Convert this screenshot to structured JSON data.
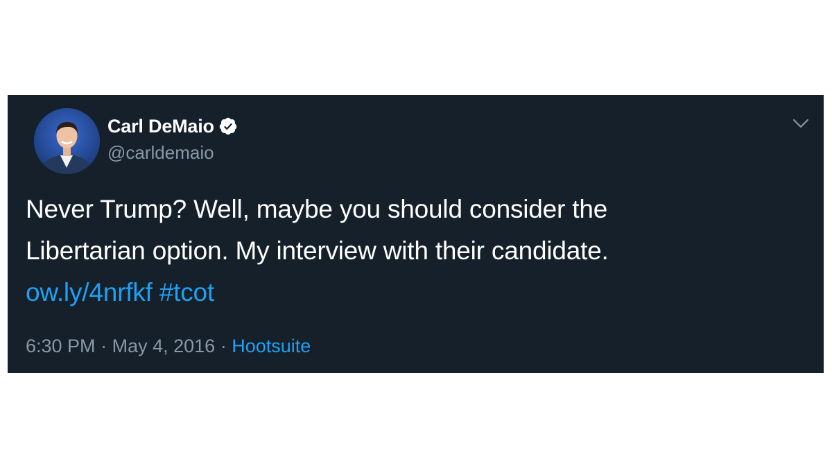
{
  "tweet": {
    "author": {
      "name": "Carl DeMaio",
      "handle": "@carldemaio",
      "verified": true,
      "verified_icon": "verified-badge-icon",
      "avatar_icon": "profile-photo"
    },
    "menu_icon": "chevron-down-icon",
    "text_lines": [
      "Never Trump? Well, maybe you should consider the",
      "Libertarian option.  My interview with their candidate."
    ],
    "link": "ow.ly/4nrfkf",
    "hashtag": "#tcot",
    "time": "6:30 PM",
    "separator": "·",
    "date": "May 4, 2016",
    "source": "Hootsuite"
  },
  "colors": {
    "background": "#15202b",
    "text": "#ffffff",
    "muted": "#8899a6",
    "accent": "#1da1f2",
    "page": "#ffffff"
  }
}
